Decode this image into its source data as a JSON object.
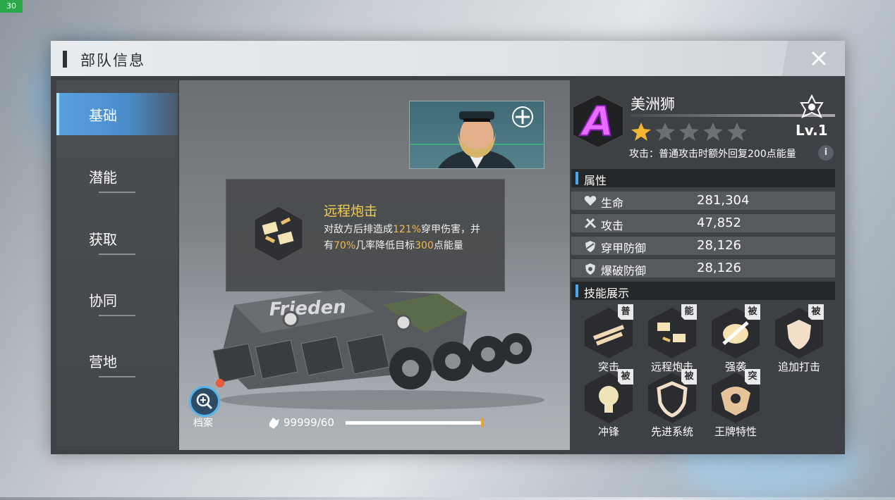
{
  "debug": {
    "fps": "30"
  },
  "header": {
    "title": "部队信息"
  },
  "sidebar": {
    "items": [
      {
        "label": "基础",
        "active": true
      },
      {
        "label": "潜能",
        "active": false
      },
      {
        "label": "获取",
        "active": false
      },
      {
        "label": "协同",
        "active": false
      },
      {
        "label": "营地",
        "active": false
      }
    ]
  },
  "stage": {
    "tank_text": "Frieden",
    "archive_label": "档案",
    "energy": {
      "value": "99999/60",
      "progress": 0.99
    }
  },
  "tooltip": {
    "name": "远程炮击",
    "desc": [
      {
        "text": "对敌方后排造成",
        "hl": false
      },
      {
        "text": "121%",
        "hl": true
      },
      {
        "text": "穿甲伤害，并有",
        "hl": false
      },
      {
        "text": "70%",
        "hl": true
      },
      {
        "text": "几率降低目标",
        "hl": false
      },
      {
        "text": "300",
        "hl": true
      },
      {
        "text": "点能量",
        "hl": false
      }
    ]
  },
  "unit": {
    "rank": "A",
    "name": "美洲狮",
    "stars": 1,
    "max_stars": 5,
    "level": "Lv.1",
    "passive": "攻击：普通攻击时额外回复200点能量",
    "info_icon": "i"
  },
  "sections": {
    "attributes": "属性",
    "skills": "技能展示"
  },
  "stats": [
    {
      "icon": "heart-icon",
      "label": "生命",
      "value": "281,304"
    },
    {
      "icon": "attack-icon",
      "label": "攻击",
      "value": "47,852"
    },
    {
      "icon": "shield-pierce-icon",
      "label": "穿甲防御",
      "value": "28,126"
    },
    {
      "icon": "shield-blast-icon",
      "label": "爆破防御",
      "value": "28,126"
    }
  ],
  "skills": [
    {
      "name": "突击",
      "tag": "普",
      "icon": "rush-icon"
    },
    {
      "name": "远程炮击",
      "tag": "能",
      "icon": "artillery-icon"
    },
    {
      "name": "强袭",
      "tag": "被",
      "icon": "assault-icon"
    },
    {
      "name": "追加打击",
      "tag": "被",
      "icon": "extra-strike-icon"
    },
    {
      "name": "冲锋",
      "tag": "被",
      "icon": "charge-icon"
    },
    {
      "name": "先进系统",
      "tag": "被",
      "icon": "advanced-system-icon"
    },
    {
      "name": "王牌特性",
      "tag": "突",
      "icon": "ace-trait-icon"
    }
  ],
  "colors": {
    "accent": "#4aa8f0",
    "highlight": "#f2b94d",
    "skill_name": "#f2cf4d",
    "rank": "#e040ff"
  }
}
